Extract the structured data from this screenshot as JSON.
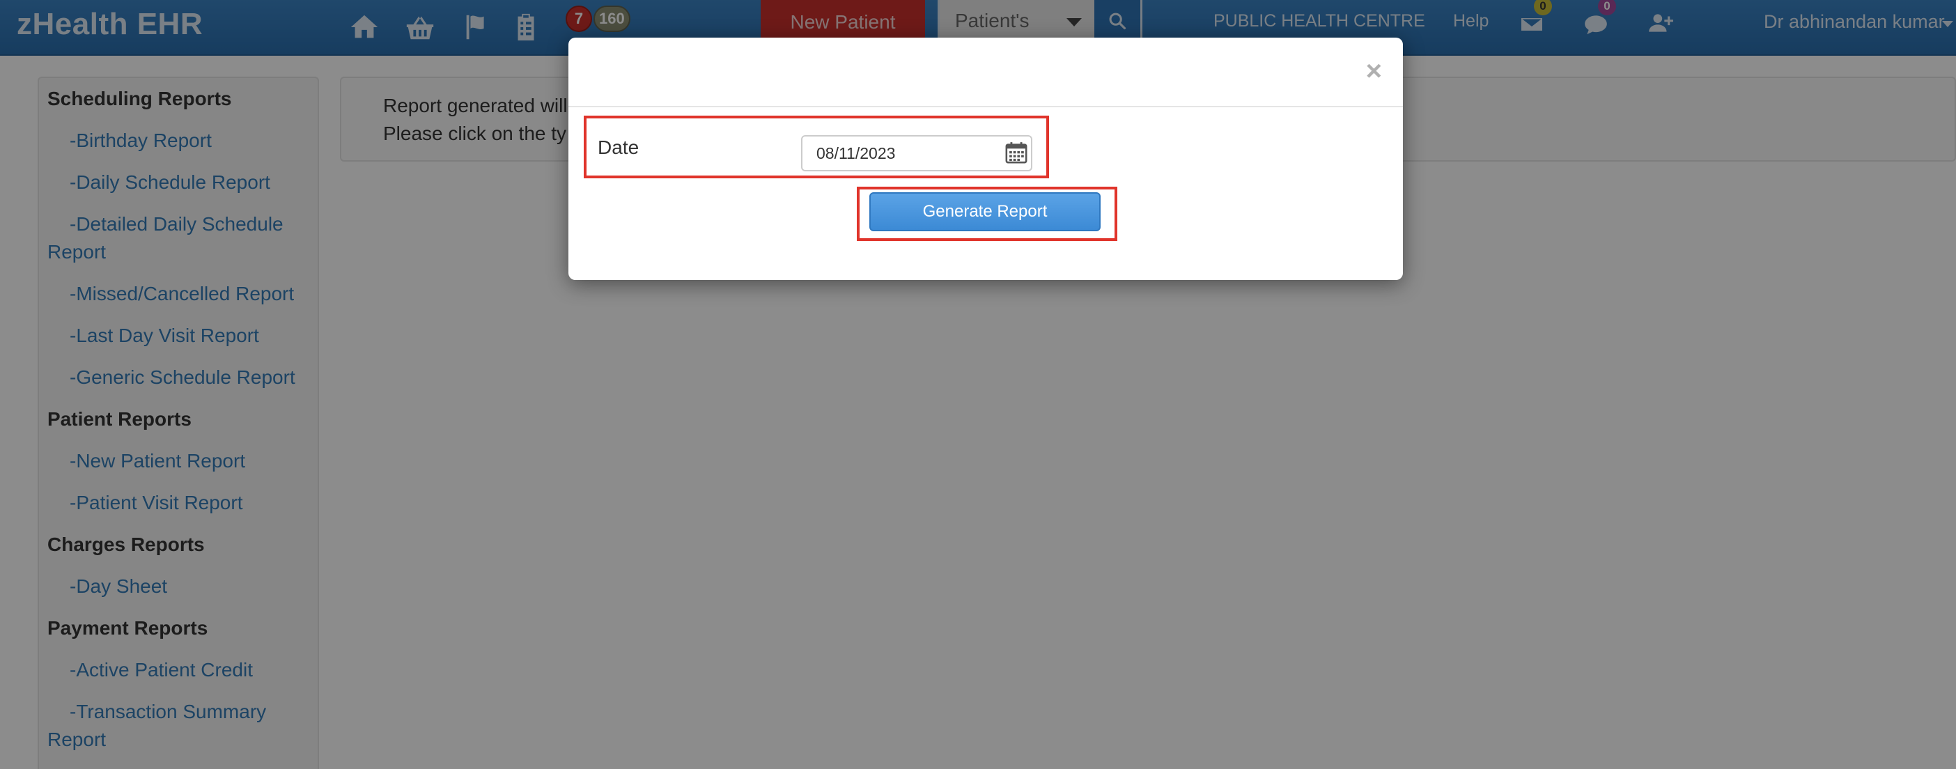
{
  "app": {
    "brand": "zHealth EHR"
  },
  "topnav": {
    "icons": [
      "home-icon",
      "basket-icon",
      "flag-icon",
      "clipboard-icon"
    ],
    "badge_red": "7",
    "badge_gray": "160",
    "new_patient_label": "New Patient",
    "search_select_value": "Patient's",
    "location": "PUBLIC HEALTH CENTRE",
    "help": "Help",
    "mail_count": "0",
    "chat_count": "0",
    "user": "Dr abhinandan kumar"
  },
  "sidebar": {
    "items": [
      {
        "type": "heading",
        "label": "Scheduling Reports"
      },
      {
        "type": "link",
        "label": "-Birthday Report"
      },
      {
        "type": "link",
        "label": "-Daily Schedule Report"
      },
      {
        "type": "link",
        "label": "-Detailed Daily Schedule"
      },
      {
        "type": "link",
        "label": "Report"
      },
      {
        "type": "link",
        "label": "-Missed/Cancelled Report"
      },
      {
        "type": "link",
        "label": "-Last Day Visit Report"
      },
      {
        "type": "link",
        "label": "-Generic Schedule Report"
      },
      {
        "type": "heading",
        "label": "Patient Reports"
      },
      {
        "type": "link",
        "label": "-New Patient Report"
      },
      {
        "type": "link",
        "label": "-Patient Visit Report"
      },
      {
        "type": "heading",
        "label": "Charges Reports"
      },
      {
        "type": "link",
        "label": "-Day Sheet"
      },
      {
        "type": "heading",
        "label": "Payment Reports"
      },
      {
        "type": "link",
        "label": "-Active Patient Credit"
      },
      {
        "type": "link",
        "label": "-Transaction Summary"
      },
      {
        "type": "link",
        "label": "Report"
      }
    ]
  },
  "main": {
    "info_line1": "Report generated will",
    "info_line2": "Please click on the ty"
  },
  "modal": {
    "close_symbol": "×",
    "date_label": "Date",
    "date_value": "08/11/2023",
    "generate_label": "Generate Report"
  },
  "colors": {
    "nav_blue": "#2f74b5",
    "link_blue": "#337ab7",
    "danger_red": "#c9302c",
    "highlight_red": "#e0342b",
    "primary_button": "#3c8ad5"
  }
}
